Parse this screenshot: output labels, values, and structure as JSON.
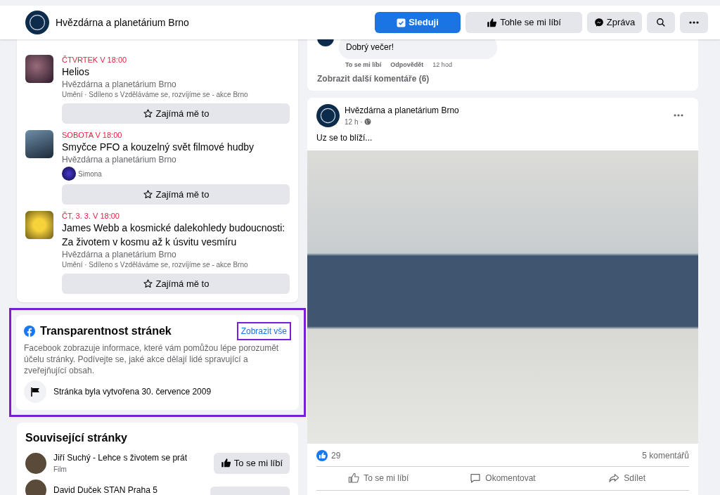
{
  "header": {
    "page_name": "Hvězdárna a planetárium Brno",
    "buttons": [
      {
        "kind": "follow",
        "label": "Sleduji"
      },
      {
        "kind": "like",
        "label": "Tohle se mi líbí"
      },
      {
        "kind": "message",
        "label": "Zpráva"
      },
      {
        "kind": "search"
      },
      {
        "kind": "more"
      }
    ]
  },
  "events": [
    {
      "date": "ČTVRTEK V 18:00",
      "title": "Helios",
      "organizer": "Hvězdárna a planetárium Brno",
      "meta": "Umění · Sdíleno s Vzděláváme se, rozvíjíme se - akce Brno",
      "button": "Zajímá mě to"
    },
    {
      "date": "SOBOTA V 18:00",
      "title": "Smyčce PFO a kouzelný svět filmové hudby",
      "organizer": "Hvězdárna a planetárium Brno",
      "friend": "Simona",
      "button": "Zajímá mě to"
    },
    {
      "date": "ČT, 3. 3. V 18:00",
      "title": "James Webb a kosmické dalekohledy budoucnosti: Za životem v kosmu až k úsvitu vesmíru",
      "organizer": "Hvězdárna a planetárium Brno",
      "meta": "Umění · Sdíleno s Vzděláváme se, rozvíjíme se - akce Brno",
      "button": "Zajímá mě to"
    }
  ],
  "transparency": {
    "title": "Transparentnost stránek",
    "link": "Zobrazit vše",
    "highlighted": true,
    "text": "Facebook zobrazuje informace, které vám pomůžou lépe porozumět účelu stránky. Podívejte se, jaké akce dělají lidé spravující a zveřejňující obsah.",
    "created": "Stránka byla vytvořena 30. července 2009"
  },
  "related": {
    "title": "Související stránky",
    "pages": [
      {
        "name": "Jiří Suchý - Lehce s životem se prát",
        "category": "Film",
        "button": "To se mi líbí"
      },
      {
        "name": "David Duček STAN Praha 5"
      }
    ]
  },
  "comment": {
    "text": "Dobrý večer!",
    "actions": [
      "To se mi líbí",
      "Odpovědět"
    ],
    "time": "12 hod",
    "more": "Zobrazit další komentáře (6)"
  },
  "post": {
    "author": "Hvězdárna a planetárium Brno",
    "time": "12 h ·",
    "text": "Uz se to blíží...",
    "likes": "29",
    "comments": "5 komentářů",
    "actions": [
      {
        "kind": "like",
        "label": "To se mi líbí"
      },
      {
        "kind": "comment",
        "label": "Okomentovat"
      },
      {
        "kind": "share",
        "label": "Sdílet"
      }
    ]
  }
}
